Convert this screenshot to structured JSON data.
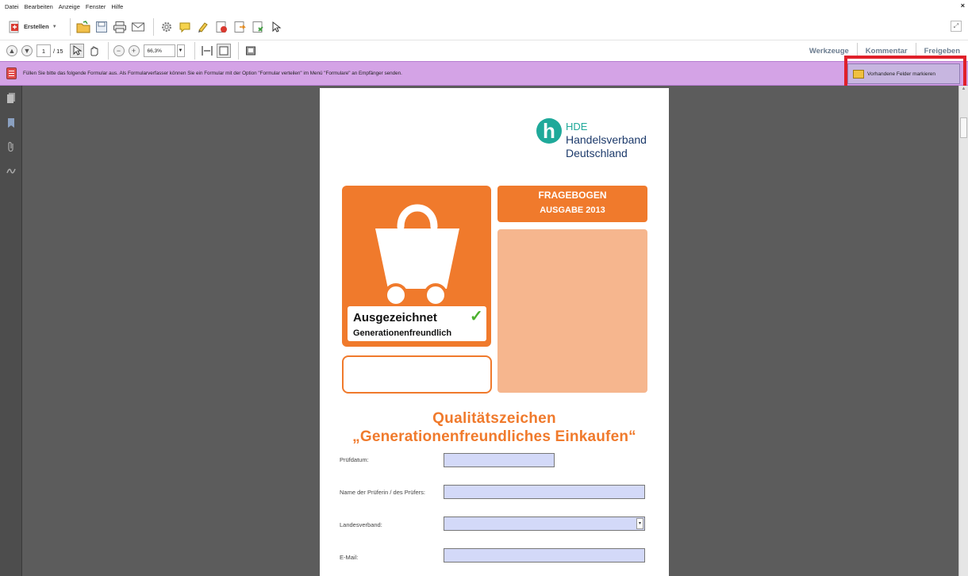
{
  "menu": {
    "items": [
      "Datei",
      "Bearbeiten",
      "Anzeige",
      "Fenster",
      "Hilfe"
    ],
    "close": "×"
  },
  "toolbar": {
    "create_label": "Erstellen",
    "current_page": "1",
    "total_pages": "/ 15",
    "zoom": "66,3%"
  },
  "right_tabs": [
    "Werkzeuge",
    "Kommentar",
    "Freigeben"
  ],
  "formbar": {
    "message": "Füllen Sie bitte das folgende Formular aus. Als Formularverfasser können Sie ein Formular mit der Option \"Formular verteilen\" im Menü \"Formulare\" an Empfänger senden.",
    "mark_button": "Vorhandene Felder markieren"
  },
  "document": {
    "logo_letter": "h",
    "logo_lines": [
      "HDE",
      "Handelsverband",
      "Deutschland"
    ],
    "award_line1": "Ausgezeichnet",
    "award_check": "✓",
    "award_line2": "Generationenfreundlich",
    "frage_line1": "FRAGEBOGEN",
    "frage_line2": "AUSGABE 2013",
    "title_line1": "Qualitätszeichen",
    "title_line2": "„Generationenfreundliches Einkaufen“",
    "fields": [
      {
        "label": "Prüfdatum:",
        "value": ""
      },
      {
        "label": "Name der Prüferin / des Prüfers:",
        "value": ""
      },
      {
        "label": "Landesverband:",
        "value": ""
      },
      {
        "label": "E-Mail:",
        "value": ""
      }
    ]
  },
  "colors": {
    "form_bar": "#d4a3e6",
    "accent_orange": "#f07a2c",
    "field_fill": "#d3d9f8",
    "highlight": "#e0202a"
  }
}
